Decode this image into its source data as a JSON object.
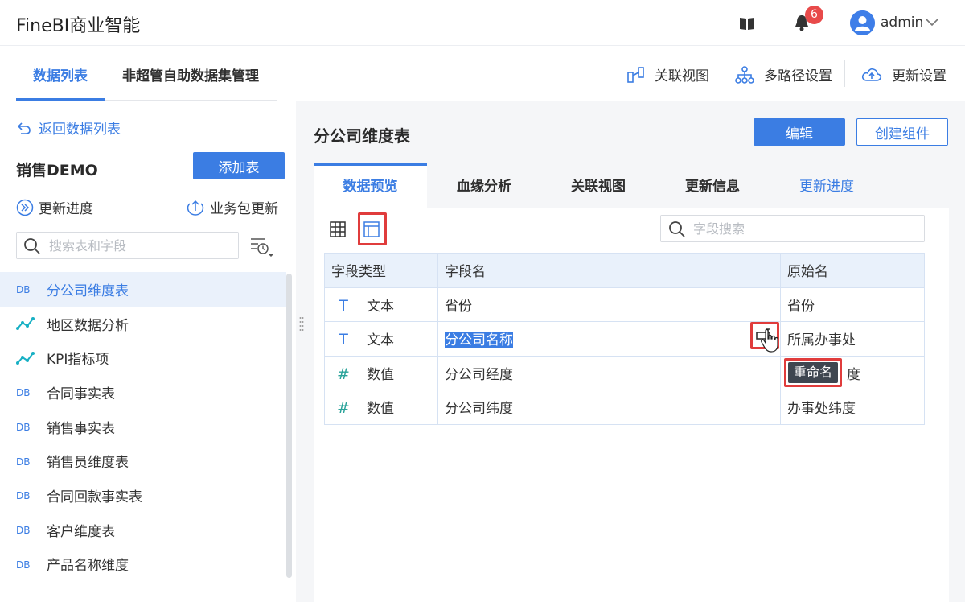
{
  "header": {
    "brand": "FineBI商业智能",
    "notification_count": "6",
    "username": "admin"
  },
  "top_tabs": [
    {
      "label": "数据列表",
      "active": true
    },
    {
      "label": "非超管自助数据集管理",
      "active": false
    }
  ],
  "top_actions": {
    "relation_view": "关联视图",
    "multipath": "多路径设置",
    "update_settings": "更新设置"
  },
  "sidebar": {
    "back_label": "返回数据列表",
    "package_title": "销售DEMO",
    "add_table_label": "添加表",
    "update_progress": "更新进度",
    "package_update": "业务包更新",
    "search_placeholder": "搜索表和字段",
    "tables": [
      {
        "label": "分公司维度表",
        "icon": "db-icon",
        "selected": true
      },
      {
        "label": "地区数据分析",
        "icon": "self-service-dataset-icon"
      },
      {
        "label": "KPI指标项",
        "icon": "self-service-dataset-icon"
      },
      {
        "label": "合同事实表",
        "icon": "db-icon"
      },
      {
        "label": "销售事实表",
        "icon": "db-icon"
      },
      {
        "label": "销售员维度表",
        "icon": "db-icon"
      },
      {
        "label": "合同回款事实表",
        "icon": "db-icon"
      },
      {
        "label": "客户维度表",
        "icon": "db-icon"
      },
      {
        "label": "产品名称维度",
        "icon": "db-icon"
      }
    ]
  },
  "main": {
    "title": "分公司维度表",
    "edit_label": "编辑",
    "create_component_label": "创建组件",
    "tabs": [
      {
        "label": "数据预览",
        "active": true
      },
      {
        "label": "血缘分析"
      },
      {
        "label": "关联视图"
      },
      {
        "label": "更新信息"
      },
      {
        "label": "更新进度"
      }
    ],
    "field_search_placeholder": "字段搜索",
    "table": {
      "headers": [
        "字段类型",
        "字段名",
        "原始名"
      ],
      "rows": [
        {
          "type_icon": "T",
          "type": "文本",
          "name": "省份",
          "original": "省份"
        },
        {
          "type_icon": "T",
          "type": "文本",
          "name": "分公司名称",
          "original": "所属办事处"
        },
        {
          "type_icon": "#",
          "type": "数值",
          "name": "分公司经度",
          "original": "度"
        },
        {
          "type_icon": "#",
          "type": "数值",
          "name": "分公司纬度",
          "original": "办事处纬度"
        }
      ]
    },
    "tooltip": "重命名"
  },
  "colors": {
    "accent": "#3b7de3",
    "highlight": "#e03c3c",
    "badge": "#e84a4a"
  }
}
